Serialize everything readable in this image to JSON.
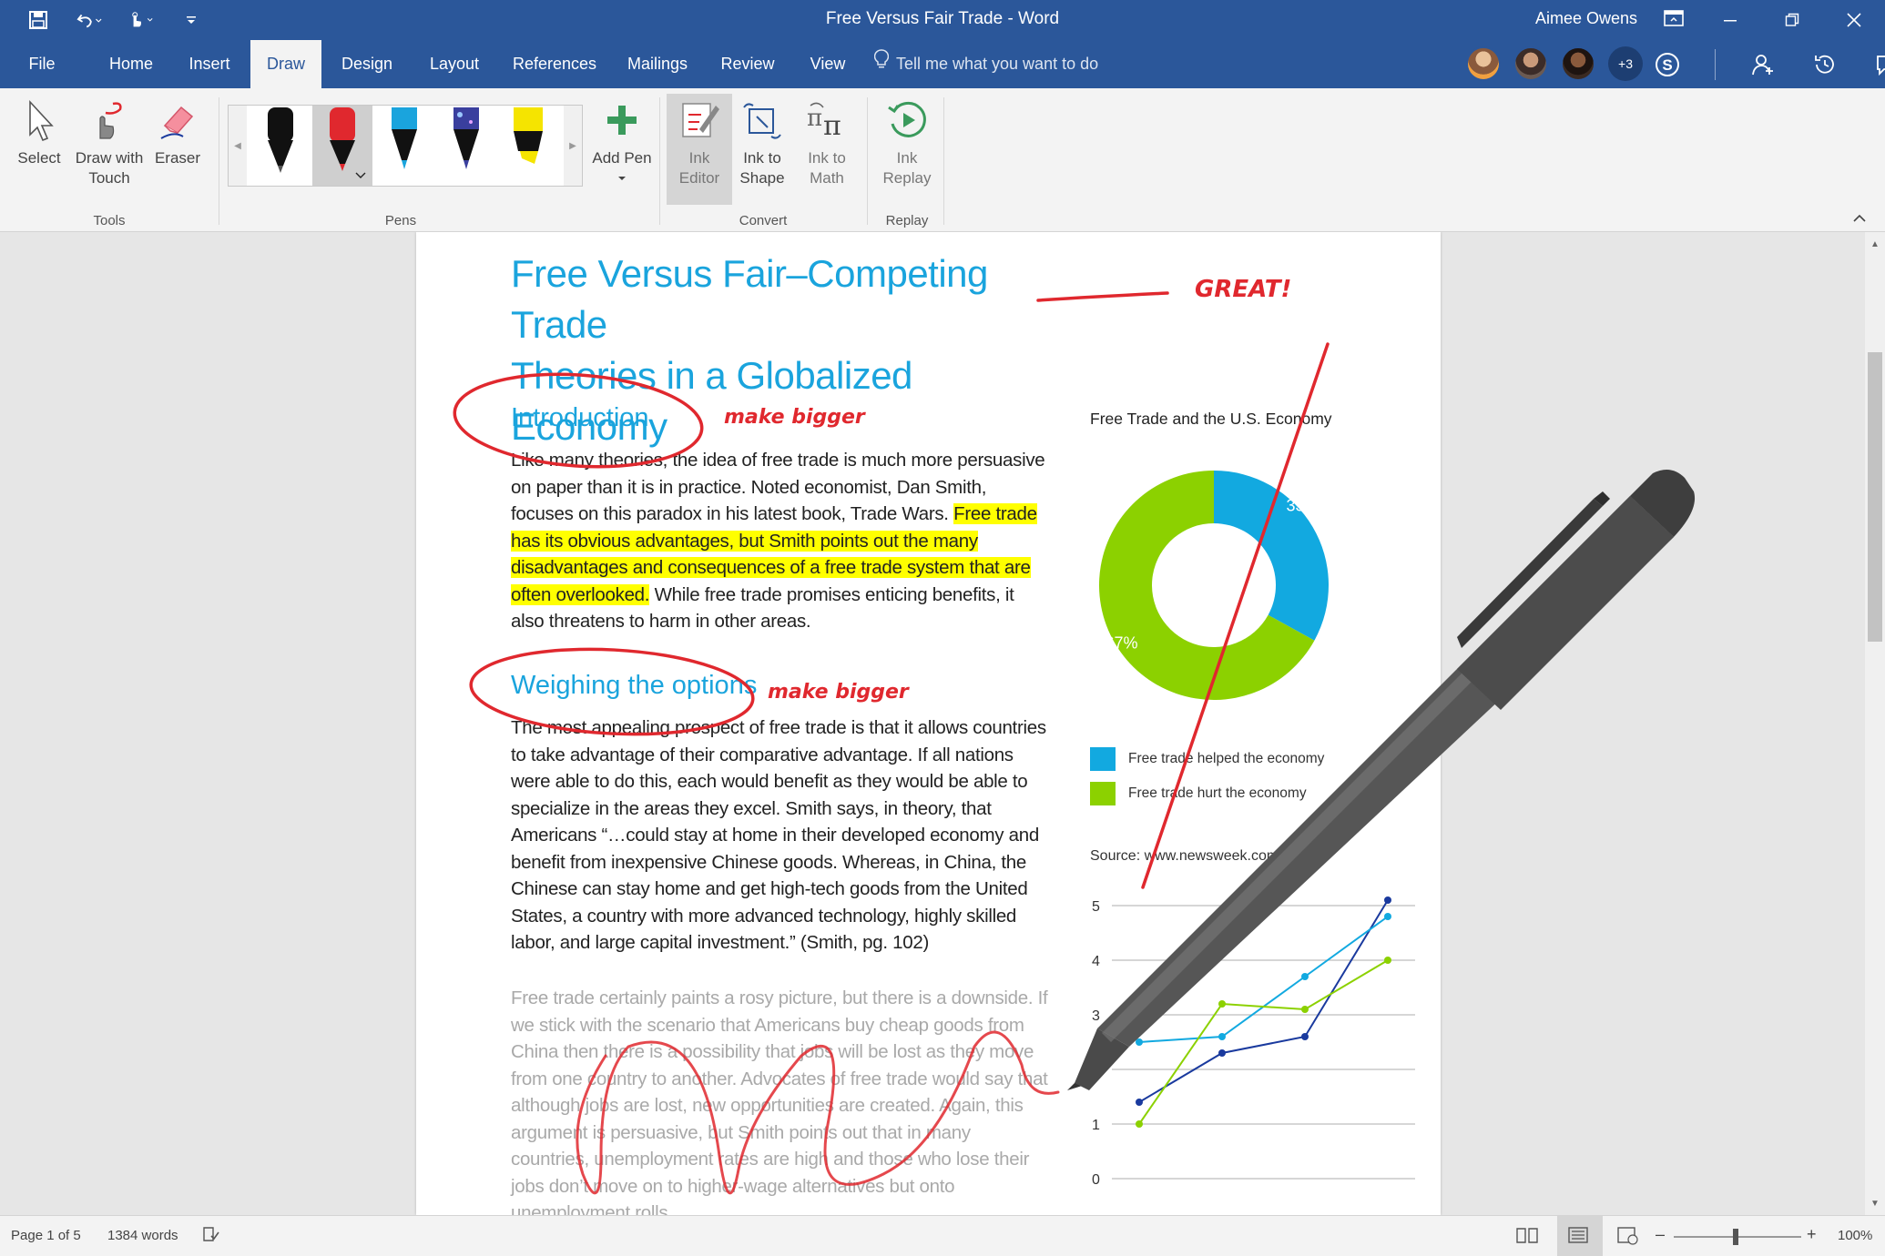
{
  "window": {
    "title": "Free Versus Fair Trade - Word",
    "user": "Aimee Owens",
    "collaborators_more": "+3"
  },
  "tabs": [
    "File",
    "Home",
    "Insert",
    "Draw",
    "Design",
    "Layout",
    "References",
    "Mailings",
    "Review",
    "View"
  ],
  "active_tab": "Draw",
  "tell_me": "Tell me what you want to do",
  "ribbon": {
    "tools": {
      "select": "Select",
      "draw_with_touch_1": "Draw with",
      "draw_with_touch_2": "Touch",
      "eraser": "Eraser",
      "group_label": "Tools"
    },
    "pens": {
      "group_label": "Pens",
      "add_pen": "Add Pen",
      "pen_colors": [
        "#111111",
        "#e0282e",
        "#1aa4dd",
        "#3a3f9e",
        "#f5e400"
      ]
    },
    "convert": {
      "ink_editor_1": "Ink",
      "ink_editor_2": "Editor",
      "ink_to_shape_1": "Ink to",
      "ink_to_shape_2": "Shape",
      "ink_to_math_1": "Ink to",
      "ink_to_math_2": "Math",
      "group_label": "Convert"
    },
    "replay": {
      "ink_replay_1": "Ink",
      "ink_replay_2": "Replay",
      "group_label": "Replay"
    }
  },
  "document": {
    "title_line1": "Free Versus Fair–Competing Trade",
    "title_line2": "Theories in a Globalized Economy",
    "intro_heading": "Introduction",
    "intro_para_before": "Like many theories, the idea of free trade is much more persuasive on paper than it is in practice. Noted economist, Dan Smith, focuses on this paradox in his latest book, Trade Wars. ",
    "intro_para_highlight": "Free trade has its obvious advantages, but Smith points out the many disadvantages and consequences of a free trade system that are often overlooked.",
    "intro_para_after": " While free trade promises enticing benefits, it also threatens to harm in other areas.",
    "options_heading": "Weighing the options",
    "options_para": "The most appealing prospect of free trade is that it allows countries to take advantage of their comparative advantage. If all nations were able to do this, each would benefit as they would be able to specialize in the areas they excel. Smith says, in theory, that Americans “…could stay at home in their developed economy and benefit from inexpensive Chinese goods. Whereas, in China, the Chinese can stay home and get high-tech goods from the United States, a country with more advanced technology, highly skilled labor, and large capital investment.” (Smith, pg. 102)",
    "faded_para": "Free trade certainly paints a rosy picture, but there is a downside. If we stick with the scenario that Americans buy cheap goods from China then there is a possibility that jobs will be lost as they move from one country to another. Advocates of free trade would say that although jobs are lost, new opportunities are created. Again, this argument is persuasive, but Smith points out that in many countries, unemployment rates are high and those who lose their jobs don’t move on to higher-wage alternatives but onto unemployment rolls."
  },
  "annotations": {
    "great": "GREAT!",
    "make_bigger_1": "make bigger",
    "make_bigger_2": "make bigger"
  },
  "chart_data": [
    {
      "type": "pie",
      "title": "Free Trade and the U.S. Economy",
      "slices": [
        {
          "label": "Free trade helped the economy",
          "value": 33,
          "display": "33%",
          "color": "#12a9e0"
        },
        {
          "label": "Free trade hurt the economy",
          "value": 67,
          "display": "67%",
          "color": "#8cd100"
        }
      ],
      "source": "Source: www.newsweek.com"
    },
    {
      "type": "line",
      "y_ticks": [
        "5",
        "4",
        "3",
        "2",
        "1",
        "0"
      ],
      "ylim": [
        0,
        5
      ],
      "grid": true,
      "series": [
        {
          "color": "#1a3a9e",
          "points": [
            [
              0,
              1.4
            ],
            [
              1,
              2.3
            ],
            [
              2,
              2.6
            ],
            [
              3,
              5.1
            ]
          ]
        },
        {
          "color": "#12a9e0",
          "points": [
            [
              0,
              2.5
            ],
            [
              1,
              2.6
            ],
            [
              2,
              3.7
            ],
            [
              3,
              4.8
            ]
          ]
        },
        {
          "color": "#8cd100",
          "points": [
            [
              0,
              1.0
            ],
            [
              1,
              3.2
            ],
            [
              2,
              3.1
            ],
            [
              3,
              4.0
            ]
          ]
        }
      ]
    }
  ],
  "status": {
    "page": "Page 1 of 5",
    "words": "1384 words",
    "zoom": "100%"
  }
}
